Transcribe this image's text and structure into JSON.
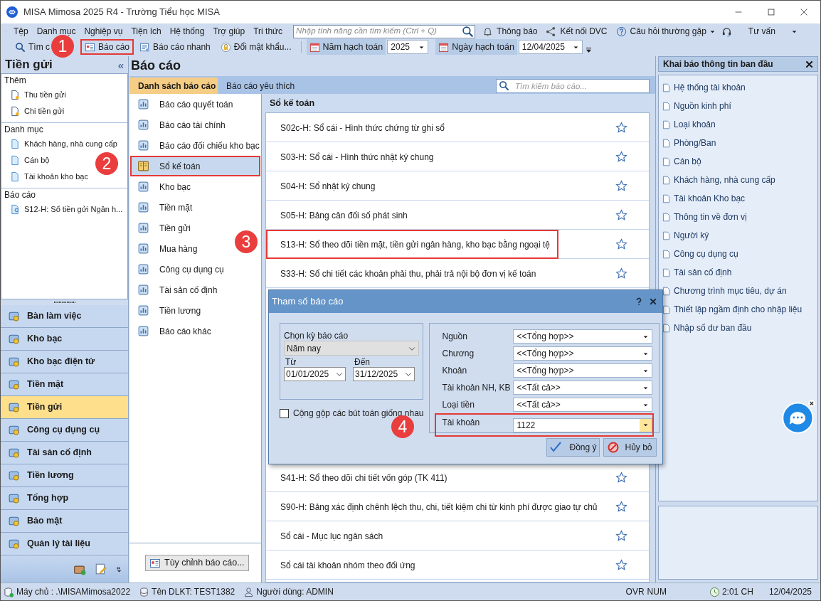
{
  "window": {
    "title": "MISA Mimosa 2025 R4 - Trường Tiểu học MISA"
  },
  "menu": [
    "Tệp",
    "Danh mục",
    "Nghiệp vụ",
    "Tiện ích",
    "Hệ thống",
    "Trợ giúp",
    "Tri thức"
  ],
  "feature_search": {
    "placeholder": "Nhập tính năng cần tìm kiếm (Ctrl + Q)"
  },
  "menu_right": [
    {
      "kind": "bell",
      "label": "Thông báo"
    },
    {
      "kind": "share",
      "label": "Kết nối DVC"
    },
    {
      "kind": "help",
      "label": "Câu hỏi thường gặp",
      "dropdown": true
    },
    {
      "kind": "headset",
      "label": "Tư vấn",
      "dropdown": true
    }
  ],
  "toolbar": [
    {
      "kind": "search",
      "label": "Tìm c",
      "highlighted": false
    },
    {
      "kind": "report",
      "label": "Báo cáo",
      "highlighted": true
    },
    {
      "kind": "quick",
      "label": "Báo cáo nhanh",
      "highlighted": false
    },
    {
      "kind": "lock",
      "label": "Đổi mật khẩu...",
      "highlighted": false
    }
  ],
  "fiscal_year": {
    "label": "Năm hạch toán",
    "value": "2025"
  },
  "posting_date": {
    "label": "Ngày hạch toán",
    "value": "12/04/2025"
  },
  "left_panel": {
    "title": "Tiền gửi",
    "collapse": "«",
    "sections": [
      {
        "title": "Thêm",
        "items": [
          {
            "kind": "new",
            "label": "Thu tiền gửi"
          },
          {
            "kind": "new",
            "label": "Chi tiền gửi"
          }
        ]
      },
      {
        "title": "Danh mục",
        "items": [
          {
            "kind": "doc",
            "label": "Khách hàng, nhà cung cấp"
          },
          {
            "kind": "doc",
            "label": "Cán bộ"
          },
          {
            "kind": "doc",
            "label": "Tài khoản kho bạc"
          }
        ]
      },
      {
        "title": "Báo cáo",
        "items": [
          {
            "kind": "report",
            "label": "S12-H: Sổ tiền gửi Ngân h..."
          }
        ]
      }
    ],
    "nav": [
      {
        "label": "Bàn làm việc",
        "selected": false
      },
      {
        "label": "Kho bạc",
        "selected": false
      },
      {
        "label": "Kho bạc điện tử",
        "selected": false
      },
      {
        "label": "Tiền mặt",
        "selected": false
      },
      {
        "label": "Tiền gửi",
        "selected": true
      },
      {
        "label": "Công cụ dụng cụ",
        "selected": false
      },
      {
        "label": "Tài sản cố định",
        "selected": false
      },
      {
        "label": "Tiền lương",
        "selected": false
      },
      {
        "label": "Tổng hợp",
        "selected": false
      },
      {
        "label": "Bảo mật",
        "selected": false
      },
      {
        "label": "Quản lý tài liệu",
        "selected": false
      }
    ]
  },
  "reports": {
    "title": "Báo cáo",
    "tabs": [
      {
        "label": "Danh sách báo cáo",
        "selected": true
      },
      {
        "label": "Báo cáo yêu thích",
        "selected": false
      }
    ],
    "search": {
      "placeholder": "Tìm kiếm báo cáo..."
    },
    "categories": [
      {
        "label": "Báo cáo quyết toán",
        "selected": false,
        "highlighted": false
      },
      {
        "label": "Báo cáo tài chính",
        "selected": false,
        "highlighted": false
      },
      {
        "label": "Báo cáo đối chiếu kho bạc",
        "selected": false,
        "highlighted": false
      },
      {
        "label": "Sổ kế toán",
        "selected": true,
        "highlighted": true
      },
      {
        "label": "Kho bạc",
        "selected": false,
        "highlighted": false
      },
      {
        "label": "Tiền mặt",
        "selected": false,
        "highlighted": false
      },
      {
        "label": "Tiền gửi",
        "selected": false,
        "highlighted": false
      },
      {
        "label": "Mua hàng",
        "selected": false,
        "highlighted": false
      },
      {
        "label": "Công cụ dụng cụ",
        "selected": false,
        "highlighted": false
      },
      {
        "label": "Tài sản cố định",
        "selected": false,
        "highlighted": false
      },
      {
        "label": "Tiền lương",
        "selected": false,
        "highlighted": false
      },
      {
        "label": "Báo cáo khác",
        "selected": false,
        "highlighted": false
      }
    ],
    "customize_button": "Tùy chỉnh báo cáo...",
    "list_title": "Sổ kế toán",
    "rows_top": [
      {
        "label": "S02c-H: Sổ cái - Hình thức chứng từ ghi sổ",
        "highlighted": false
      },
      {
        "label": "S03-H: Sổ cái - Hình thức nhật ký chung",
        "highlighted": false
      },
      {
        "label": "S04-H: Sổ nhật ký chung",
        "highlighted": false
      },
      {
        "label": "S05-H: Bảng cân đối số phát sinh",
        "highlighted": false
      },
      {
        "label": "S13-H: Sổ theo dõi tiền mặt, tiền gửi ngân hàng, kho bạc bằng ngoại tệ",
        "highlighted": true
      },
      {
        "label": "S33-H: Sổ chi tiết các khoản phải thu, phải trả nội bộ đơn vị kế toán",
        "highlighted": false
      }
    ],
    "rows_bottom": [
      {
        "label": "S41-H: Sổ theo dõi chi tiết vốn góp (TK 411)",
        "highlighted": false
      },
      {
        "label": "S90-H: Bảng xác định chênh lệch thu, chi, tiết kiệm chi từ kinh phí được giao tự chủ",
        "highlighted": false
      },
      {
        "label": "Sổ cái - Mục lục ngân sách",
        "highlighted": false
      },
      {
        "label": "Sổ cái tài khoản nhóm theo đối ứng",
        "highlighted": false
      }
    ]
  },
  "right_panel": {
    "title": "Khai báo thông tin ban đầu",
    "items": [
      "Hệ thống tài khoản",
      "Nguồn kinh phí",
      "Loại khoản",
      "Phòng/Ban",
      "Cán bộ",
      "Khách hàng, nhà cung cấp",
      "Tài khoản Kho bạc",
      "Thông tin về đơn vị",
      "Người ký",
      "Công cụ dụng cụ",
      "Tài sản cố định",
      "Chương trình mục tiêu, dự án",
      "Thiết lập ngầm định cho nhập liệu",
      "Nhập số dư ban đầu"
    ]
  },
  "dialog": {
    "title": "Tham số báo cáo",
    "period_label": "Chọn kỳ báo cáo",
    "period": "Năm nay",
    "from_label": "Từ",
    "from": "01/01/2025",
    "to_label": "Đến",
    "to": "31/12/2025",
    "merge": {
      "label": "Cộng gộp các bút toán giống nhau",
      "checked": false
    },
    "params": [
      {
        "label": "Nguồn",
        "value": "<<Tổng hợp>>",
        "highlighted": false
      },
      {
        "label": "Chương",
        "value": "<<Tổng hợp>>",
        "highlighted": false
      },
      {
        "label": "Khoản",
        "value": "<<Tổng hợp>>",
        "highlighted": false
      },
      {
        "label": "Tài khoản NH, KB",
        "value": "<<Tất cả>>",
        "highlighted": false
      },
      {
        "label": "Loại tiền",
        "value": "<<Tất cả>>",
        "highlighted": false
      },
      {
        "label": "Tài khoản",
        "value": "1122",
        "highlighted": true
      }
    ],
    "ok": "Đồng ý",
    "cancel": "Hủy bỏ"
  },
  "callouts": [
    "1",
    "2",
    "3",
    "4"
  ],
  "status_bar": [
    {
      "kind": "server",
      "label": "Máy chủ : .\\MISAMimosa2022"
    },
    {
      "kind": "db",
      "label": "Tên DLKT: TEST1382"
    },
    {
      "kind": "user",
      "label": "Người dùng: ADMIN"
    },
    {
      "kind": "text",
      "label": "OVR"
    },
    {
      "kind": "text",
      "label": "NUM"
    },
    {
      "kind": "clock",
      "label": "2:01 CH"
    },
    {
      "kind": "text",
      "label": "12/04/2025"
    }
  ]
}
